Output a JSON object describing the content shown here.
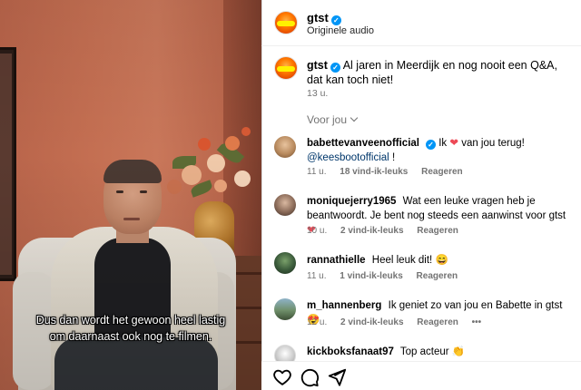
{
  "header": {
    "account_name": "gtst",
    "audio_label": "Originele audio"
  },
  "caption": {
    "username": "gtst",
    "text": "Al jaren in Meerdijk en nog nooit een Q&A, dat kan toch niet!",
    "time": "13 u."
  },
  "filter": {
    "label": "Voor jou"
  },
  "video": {
    "subtitle_line1": "Dus dan wordt het gewoon heel lastig",
    "subtitle_line2": "om daarnaast ook nog te filmen."
  },
  "comments": [
    {
      "username": "babettevanveenofficial",
      "verified": true,
      "text_before": "Ik",
      "emoji": "❤",
      "text_after": "van jou terug!",
      "mention": "@keesbootofficial",
      "mention_suffix": "!",
      "time": "11 u.",
      "likes": "18 vind-ik-leuks",
      "reply": "Reageren"
    },
    {
      "username": "moniquejerry1965",
      "text": "Wat een leuke vragen heb je beantwoordt. Je bent nog steeds een aanwinst voor gtst",
      "emoji": "❤",
      "time": "10 u.",
      "likes": "2 vind-ik-leuks",
      "reply": "Reageren"
    },
    {
      "username": "rannathielle",
      "text": "Heel leuk dit!",
      "emoji": "😄",
      "time": "11 u.",
      "likes": "1 vind-ik-leuks",
      "reply": "Reageren"
    },
    {
      "username": "m_hannenberg",
      "text": "Ik geniet zo van jou en Babette in gtst",
      "emoji": "😍",
      "time": "12 u.",
      "likes": "2 vind-ik-leuks",
      "reply": "Reageren",
      "more": "•••"
    },
    {
      "username": "kickboksfanaat97",
      "text": "Top acteur",
      "emoji": "👏"
    }
  ],
  "colors": {
    "verified": "#0095f6",
    "meta_text": "#737373",
    "mention": "#00376b",
    "heart": "#ed4956"
  },
  "icons": [
    "heart-icon",
    "comment-icon",
    "share-icon",
    "verified-icon",
    "chevron-down-icon",
    "more-icon"
  ]
}
